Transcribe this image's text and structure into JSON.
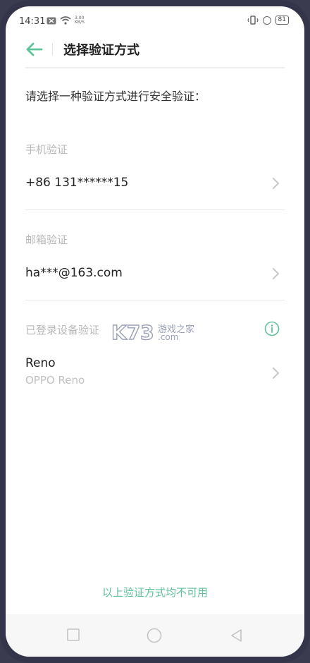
{
  "status_bar": {
    "time": "14:31",
    "speed_value": "3.00",
    "speed_unit": "KB/S",
    "battery": "81"
  },
  "header": {
    "title": "选择验证方式"
  },
  "prompt": "请选择一种验证方式进行安全验证：",
  "sections": {
    "phone": {
      "title": "手机验证",
      "value": "+86 131******15"
    },
    "email": {
      "title": "邮箱验证",
      "value": "ha***@163.com"
    },
    "device": {
      "title": "已登录设备验证",
      "name": "Reno",
      "model": "OPPO Reno"
    }
  },
  "watermark": {
    "logo": "K73",
    "cn": "游戏之家",
    "com": ".com"
  },
  "footer": {
    "unavailable": "以上验证方式均不可用"
  },
  "colors": {
    "accent": "#5fc39a",
    "muted": "#b8b8b8"
  },
  "icons": {
    "back": "arrow-left-icon",
    "chevron": "chevron-right-icon",
    "info": "info-icon"
  }
}
